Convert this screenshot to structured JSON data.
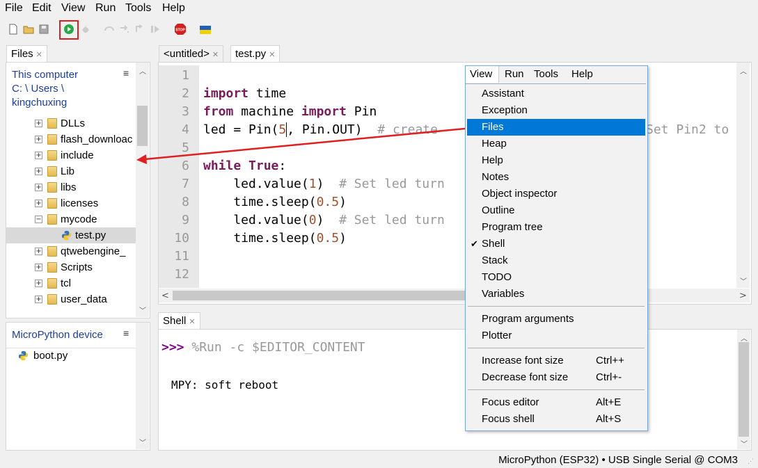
{
  "menubar": [
    "File",
    "Edit",
    "View",
    "Run",
    "Tools",
    "Help"
  ],
  "files_panel": {
    "tab": "Files",
    "this_computer_title": "This computer",
    "path_line1": "C: \\ Users \\",
    "path_line2": "kingchuxing",
    "tree": [
      "DLLs",
      "flash_downloac",
      "include",
      "Lib",
      "libs",
      "licenses",
      "mycode",
      "test.py",
      "qtwebengine_",
      "Scripts",
      "tcl",
      "user_data"
    ],
    "device_title": "MicroPython device",
    "device_files": [
      "boot.py"
    ]
  },
  "editor": {
    "tabs": [
      "<untitled>",
      "test.py"
    ],
    "line_numbers": [
      "1",
      "2",
      "3",
      "4",
      "5",
      "6",
      "7",
      "8",
      "9",
      "10",
      "11",
      "12"
    ],
    "code": {
      "l2_kw": "import",
      "l2_rest": " time",
      "l3_kw1": "from",
      "l3_mid": " machine ",
      "l3_kw2": "import",
      "l3_rest": " Pin",
      "l4_a": "led = Pin(",
      "l4_num": "5",
      "l4_b": ", Pin.OUT)  ",
      "l4_cm": "# create",
      "l4_tail": "Set Pin2 to",
      "l6_kw1": "while",
      "l6_kw2": "True",
      "l6_rest": ":",
      "l7_a": "    led.value(",
      "l7_num": "1",
      "l7_b": ")  ",
      "l7_cm": "# Set led turn",
      "l8_a": "    time.sleep(",
      "l8_num": "0.5",
      "l8_b": ")",
      "l9_a": "    led.value(",
      "l9_num": "0",
      "l9_b": ")  ",
      "l9_cm": "# Set led turn",
      "l10_a": "    time.sleep(",
      "l10_num": "0.5",
      "l10_b": ")"
    }
  },
  "shell": {
    "tab": "Shell",
    "prompt": ">>>",
    "command": " %Run -c $EDITOR_CONTENT",
    "output": "MPY: soft reboot"
  },
  "view_menu": {
    "menubar": [
      "View",
      "Run",
      "Tools",
      "Help"
    ],
    "items": [
      "Assistant",
      "Exception",
      "Files",
      "Heap",
      "Help",
      "Notes",
      "Object inspector",
      "Outline",
      "Program tree",
      "Shell",
      "Stack",
      "TODO",
      "Variables"
    ],
    "checked": "Shell",
    "highlighted": "Files",
    "items2": [
      "Program arguments",
      "Plotter"
    ],
    "items3": [
      {
        "label": "Increase font size",
        "shortcut": "Ctrl++"
      },
      {
        "label": "Decrease font size",
        "shortcut": "Ctrl+-"
      }
    ],
    "items4": [
      {
        "label": "Focus editor",
        "shortcut": "Alt+E"
      },
      {
        "label": "Focus shell",
        "shortcut": "Alt+S"
      }
    ]
  },
  "status_bar": "MicroPython (ESP32)  •  USB Single Serial @ COM3",
  "colors": {
    "accent": "#0078d7",
    "annotation": "#e02020",
    "keyword": "#7a1c5c"
  },
  "icons": [
    "new-file-icon",
    "open-folder-icon",
    "save-icon",
    "run-icon",
    "debug-icon",
    "step-over-icon",
    "step-into-icon",
    "step-out-icon",
    "resume-icon",
    "stop-icon",
    "ukraine-flag-icon"
  ]
}
